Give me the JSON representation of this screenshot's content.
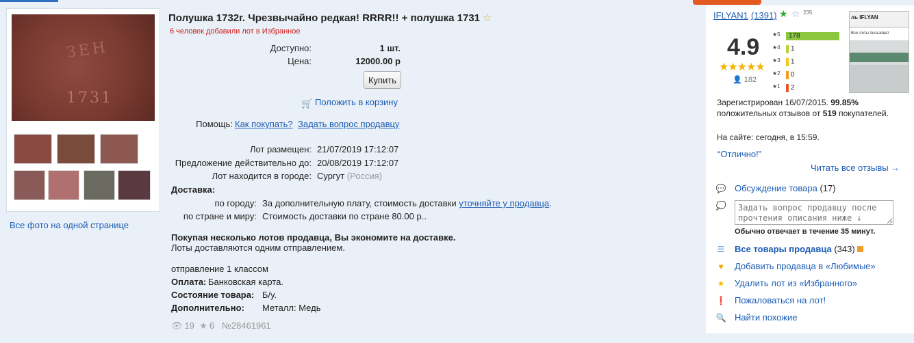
{
  "lot": {
    "title": "Полушка 1732г. Чрезвычайно редкая! RRRR!! + полушка 1731",
    "fav_count_text": "6 человек добавили лот в Избранное",
    "available_label": "Доступно:",
    "available_value": "1 шт.",
    "price_label": "Цена:",
    "price_value": "12000.00 р",
    "buy_label": "Купить",
    "cart_label": "Положить в корзину",
    "help_label": "Помощь:",
    "help_how": "Как покупать?",
    "help_ask": "Задать вопрос продавцу",
    "posted_label": "Лот размещен:",
    "posted_value": "21/07/2019 17:12:07",
    "valid_label": "Предложение действительно до:",
    "valid_value": "20/08/2019 17:12:07",
    "city_label": "Лот находится в городе:",
    "city_value": "Сургут",
    "city_country": "(Россия)",
    "delivery_heading": "Доставка:",
    "delivery_city_label": "по городу:",
    "delivery_city_text": "За дополнительную плату, стоимость доставки",
    "delivery_city_link": "уточняйте у продавца",
    "delivery_world_label": "по стране и миру:",
    "delivery_world_text": "Стоимость доставки по стране 80.00 р..",
    "multi_bold": "Покупая несколько лотов продавца, Вы экономите на доставке.",
    "multi_text": "Лоты доставляются одним отправлением.",
    "ship_class": "отправление 1 классом",
    "payment_label": "Оплата:",
    "payment_value": "Банковская карта.",
    "condition_label": "Состояние товара:",
    "condition_value": "Б/у.",
    "extra_label": "Дополнительно:",
    "extra_value": "Металл: Медь",
    "views": "19",
    "favs": "6",
    "lot_number": "№28461961"
  },
  "photos": {
    "all_photos_link": "Все фото на одной странице",
    "main_text": "ЗЕН",
    "main_year": "1731",
    "thumb_colors": [
      "#8a4a44",
      "#7a4a3a",
      "#8c5850",
      "#8a5a58",
      "#b07070",
      "#6a6a60",
      "#5a3a40"
    ]
  },
  "seller": {
    "name": "IFLYAN1",
    "count": "(1391)",
    "feedback_235": "235",
    "thumb_title": "ль IFLYAN",
    "thumb_tab": "Все лоты пользоват",
    "rating": "4.9",
    "stars": "★★★★★",
    "users": "182",
    "bars": [
      {
        "star": "★5",
        "value": "178",
        "color": "#8cc63f",
        "fraction": 1.0
      },
      {
        "star": "★4",
        "value": "1",
        "color": "#b7d432",
        "fraction": 0.03
      },
      {
        "star": "★3",
        "value": "1",
        "color": "#f2c81a",
        "fraction": 0.03
      },
      {
        "star": "★2",
        "value": "0",
        "color": "#f39a1e",
        "fraction": 0.03
      },
      {
        "star": "★1",
        "value": "2",
        "color": "#e45a2a",
        "fraction": 0.03
      }
    ],
    "reg_text_1": "Зарегистрирован 16/07/2015.",
    "reg_pct": "99.85%",
    "reg_text_2": "положительных отзывов от",
    "reg_count": "519",
    "reg_text_3": "покупателей.",
    "online": "На сайте: сегодня, в 15:59.",
    "quote": "“Отлично!”",
    "read_all": "Читать все отзывы →",
    "discuss_label": "Обсуждение товара",
    "discuss_count": "(17)",
    "ask_placeholder": "Задать вопрос продавцу после прочтения описания ниже ↓",
    "reply_time": "Обычно отвечает в течение 35 минут.",
    "all_goods": "Все товары продавца",
    "all_goods_count": "(343)",
    "add_fav_seller": "Добавить продавца в «Любимые»",
    "del_fav_lot": "Удалить лот из «Избранного»",
    "complain": "Пожаловаться на лот!",
    "similar": "Найти похожие"
  }
}
